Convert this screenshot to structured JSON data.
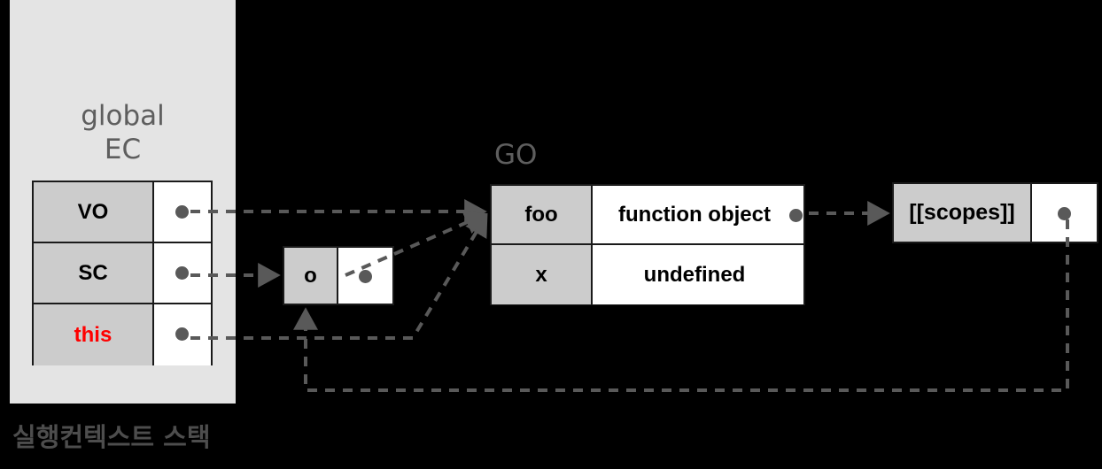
{
  "diagram": {
    "title_panel": "global\nEC",
    "stack_caption": "실행컨텍스트 스택",
    "go_label": "GO",
    "colors": {
      "background": "#000000",
      "panel": "#e4e4e4",
      "key_cell": "#cccccc",
      "value_cell": "#ffffff",
      "border": "#1a1a1a",
      "wire": "#595959",
      "label_gray": "#5e5e5e",
      "highlight_red": "#ff0000"
    }
  },
  "execution_context": {
    "name": "global EC",
    "rows": [
      {
        "key": "VO",
        "value": "",
        "has_pointer": true,
        "key_color": "#000000"
      },
      {
        "key": "SC",
        "value": "",
        "has_pointer": true,
        "key_color": "#000000"
      },
      {
        "key": "this",
        "value": "",
        "has_pointer": true,
        "key_color": "#ff0000"
      }
    ]
  },
  "scope_chain_box": {
    "rows": [
      {
        "key": "o",
        "value": "",
        "has_pointer": true
      }
    ]
  },
  "global_object": {
    "name": "GO",
    "rows": [
      {
        "key": "foo",
        "value": "function object",
        "has_pointer": true
      },
      {
        "key": "x",
        "value": "undefined",
        "has_pointer": false
      }
    ]
  },
  "scopes_slot": {
    "rows": [
      {
        "key": "[[scopes]]",
        "value": "",
        "has_pointer": true
      }
    ]
  },
  "connections": [
    {
      "from": "VO",
      "to": "GO",
      "style": "dashed-arrow"
    },
    {
      "from": "SC",
      "to": "o",
      "style": "dashed-arrow"
    },
    {
      "from": "this",
      "to": "GO",
      "style": "dashed-arrow"
    },
    {
      "from": "o",
      "to": "GO",
      "style": "dashed-arrow"
    },
    {
      "from": "foo",
      "to": "[[scopes]]",
      "style": "dashed-arrow"
    },
    {
      "from": "[[scopes]]",
      "to": "o",
      "style": "dashed-arrow"
    }
  ]
}
